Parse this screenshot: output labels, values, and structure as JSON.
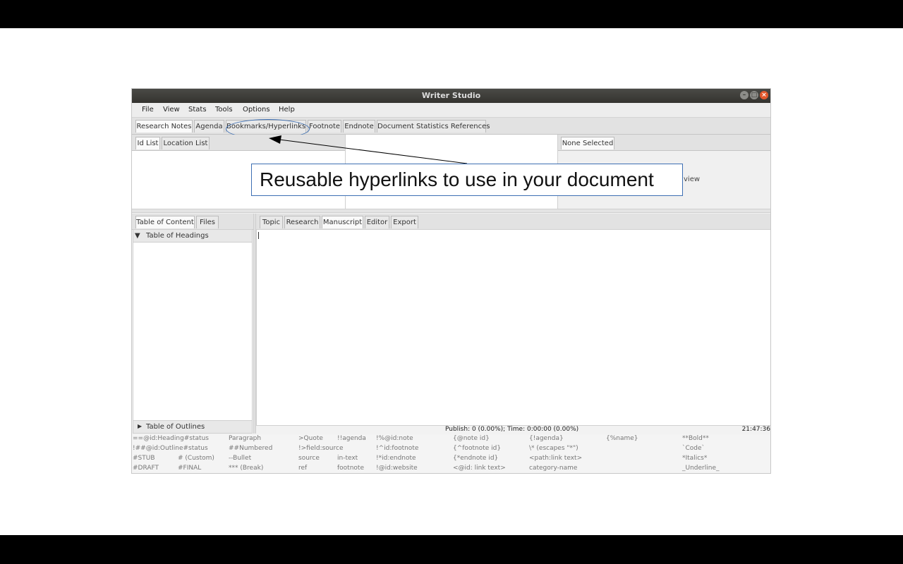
{
  "window": {
    "title": "Writer Studio",
    "controls": [
      "–",
      "□",
      "×"
    ]
  },
  "menubar": {
    "items": [
      "File",
      "View",
      "Stats",
      "Tools",
      "Options",
      "Help"
    ]
  },
  "top_tabs": {
    "items": [
      "Research Notes",
      "Agenda",
      "Bookmarks/Hyperlinks",
      "Footnote",
      "Endnote",
      "Document Statistics References"
    ]
  },
  "left_top_tabs": {
    "items": [
      "Id List",
      "Location List"
    ]
  },
  "right_top": {
    "tab": "None Selected",
    "partial_text": "view"
  },
  "left_tabs": {
    "items": [
      "Table of Content",
      "Files"
    ]
  },
  "tree": {
    "headings": "Table of Headings",
    "outlines": "Table of Outlines"
  },
  "editor_tabs": {
    "items": [
      "Topic",
      "Research",
      "Manuscript",
      "Editor",
      "Export"
    ],
    "selected": "Manuscript"
  },
  "statusbar": {
    "publish": "Publish: 0 (0.00%); Time: 0:00:00 (0.00%)",
    "clock": "21:47:36"
  },
  "hints": {
    "row1": [
      "==@id:Heading#status",
      "Paragraph",
      ">Quote",
      "!!agenda",
      "!%@id:note",
      "{@note id}",
      "{!agenda}",
      "{%name}",
      "**Bold**"
    ],
    "row2": [
      "!##@id:Outline#status",
      "##Numbered",
      "!>field:source",
      "!^id:footnote",
      "{^footnote id}",
      "\\* (escapes \"*\")",
      "`Code`"
    ],
    "row3": [
      "#STUB",
      "# (Custom)",
      "--Bullet",
      "source",
      "in-text",
      "!*id:endnote",
      "{*endnote id}",
      "<path:link text>",
      "*Italics*"
    ],
    "row4": [
      "#DRAFT",
      "#FINAL",
      "*** (Break)",
      "ref",
      "footnote",
      "!@id:website",
      "<@id: link text>",
      "category-name",
      "_Underline_"
    ]
  },
  "callout": {
    "text": "Reusable hyperlinks to use in your document"
  },
  "colors": {
    "accent": "#3d6fb3",
    "titlebar": "#3c3b37",
    "close": "#e2582c"
  }
}
